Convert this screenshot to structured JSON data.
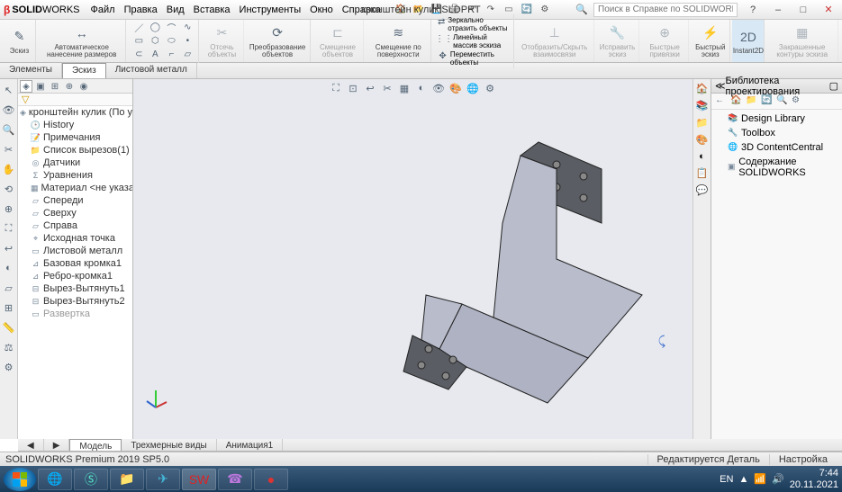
{
  "app": {
    "vendor_prefix": "SOLID",
    "vendor_suffix": "WORKS"
  },
  "menu": {
    "file": "Файл",
    "edit": "Правка",
    "view": "Вид",
    "insert": "Вставка",
    "tools": "Инструменты",
    "window": "Окно",
    "help": "Справка"
  },
  "document_title": "кронштейн кулик.SLDPRT",
  "search": {
    "placeholder": "Поиск в Справке по SOLIDWORKS"
  },
  "ribbon": {
    "sketch": "Эскиз",
    "smart_dim": "Автоматическое нанесение размеров",
    "trim": "Отсечь объекты",
    "convert": "Преобразование объектов",
    "offset": "Смещение объектов",
    "offset_surface": "Смещение по поверхности",
    "mirror": "Зеркально отразить объекты",
    "linear_pattern": "Линейный массив эскиза",
    "move": "Переместить объекты",
    "display_delete": "Отобразить/Скрыть взаимосвязи",
    "repair": "Исправить эскиз",
    "quick_snaps": "Быстрые привязки",
    "rapid_sketch": "Быстрый эскиз",
    "instant2d": "Instant2D",
    "shaded_contours": "Закрашенные контуры эскиза"
  },
  "tabs": {
    "features": "Элементы",
    "sketch": "Эскиз",
    "sheetmetal": "Листовой металл"
  },
  "tree": {
    "root": "кронштейн кулик  (По умолчанию<<П",
    "history": "History",
    "notes": "Примечания",
    "sensors": "Датчики",
    "cuts_list": "Список вырезов(1)",
    "equations": "Уравнения",
    "material": "Материал <не указан>",
    "front": "Спереди",
    "top": "Сверху",
    "right": "Справа",
    "origin": "Исходная точка",
    "sheet_metal": "Листовой металл",
    "base_flange1": "Базовая кромка1",
    "edge_flange1": "Ребро-кромка1",
    "cut_extrude1": "Вырез-Вытянуть1",
    "cut_extrude2": "Вырез-Вытянуть2",
    "flat_pattern": "Развертка"
  },
  "bottom_tabs": {
    "model": "Модель",
    "views3d": "Трехмерные виды",
    "animation": "Анимация1"
  },
  "taskpane": {
    "title": "Библиотека проектирования",
    "design_library": "Design Library",
    "toolbox": "Toolbox",
    "content_central": "3D ContentCentral",
    "sw_content": "Содержание SOLIDWORKS"
  },
  "status": {
    "version": "SOLIDWORKS Premium 2019 SP5.0",
    "mode": "Редактируется Деталь",
    "custom": "Настройка"
  },
  "taskbar": {
    "lang": "EN",
    "time": "7:44",
    "date": "20.11.2021"
  }
}
